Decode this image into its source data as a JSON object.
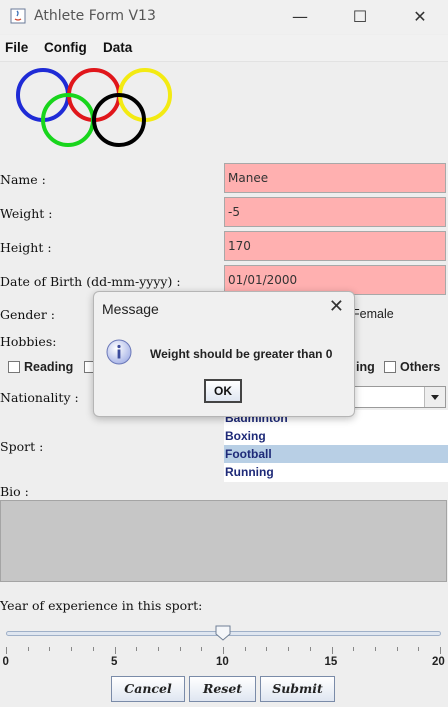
{
  "window": {
    "title": "Athlete Form V13"
  },
  "menu": {
    "items": [
      "File",
      "Config",
      "Data"
    ]
  },
  "form": {
    "name_label": "Name :",
    "name_value": "Manee",
    "weight_label": "Weight :",
    "weight_value": "-5",
    "height_label": "Height :",
    "height_value": "170",
    "dob_label": "Date of Birth (dd-mm-yyyy) :",
    "dob_value": "01/01/2000",
    "gender_label": "Gender :",
    "gender_female": "Female",
    "hobbies_label": "Hobbies:",
    "hobby_reading": "Reading",
    "hobby_partial": "ing",
    "hobby_others": "Others",
    "nationality_label": "Nationality :",
    "sport_label": "Sport :",
    "sports": [
      "Badminton",
      "Boxing",
      "Football",
      "Running"
    ],
    "selected_sport": "Football",
    "bio_label": "Bio :",
    "experience_label": "Year of experience in this sport:",
    "experience_value": 10,
    "slider_min": 0,
    "slider_max": 20,
    "slider_tick_labels": [
      "0",
      "5",
      "10",
      "15",
      "20"
    ]
  },
  "buttons": {
    "cancel": "Cancel",
    "reset": "Reset",
    "submit": "Submit"
  },
  "dialog": {
    "title": "Message",
    "message": "Weight should be greater than 0",
    "ok": "OK"
  },
  "colors": {
    "error_field_bg": "#ffb0b0",
    "list_selected_bg": "#b8cfe5",
    "list_text": "#1e2a78"
  },
  "icons": [
    "java-app-icon",
    "minimize-icon",
    "maximize-icon",
    "close-icon",
    "olympic-rings-logo",
    "info-icon",
    "chevron-down-icon"
  ]
}
